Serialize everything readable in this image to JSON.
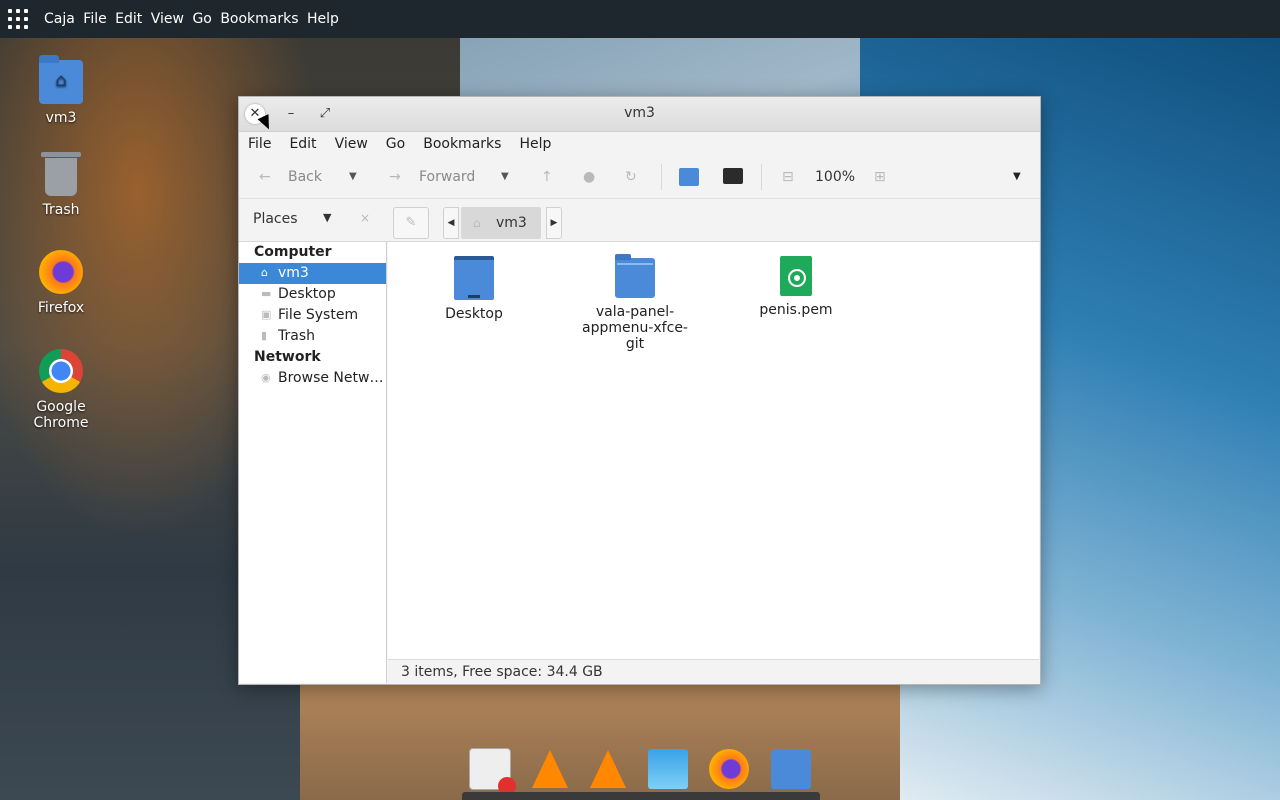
{
  "topbar": {
    "app_name": "Caja",
    "menu": [
      "File",
      "Edit",
      "View",
      "Go",
      "Bookmarks",
      "Help"
    ]
  },
  "desktop_icons": [
    {
      "label": "vm3",
      "icon": "home-folder-icon"
    },
    {
      "label": "Trash",
      "icon": "trash-icon"
    },
    {
      "label": "Firefox",
      "icon": "firefox-icon"
    },
    {
      "label": "Google Chrome",
      "icon": "chrome-icon"
    }
  ],
  "window": {
    "title": "vm3",
    "close_glyph": "✕",
    "minimize_glyph": "–",
    "maximize_glyph": "⤢",
    "menu": [
      "File",
      "Edit",
      "View",
      "Go",
      "Bookmarks",
      "Help"
    ],
    "toolbar": {
      "back_label": "Back",
      "forward_label": "Forward",
      "zoom_level": "100%"
    },
    "places": {
      "label": "Places",
      "dropdown_glyph": "▼",
      "close_glyph": "×"
    },
    "path": {
      "current": "vm3"
    },
    "sidebar": {
      "computer_header": "Computer",
      "computer_items": [
        {
          "label": "vm3",
          "icon": "home-icon",
          "active": true
        },
        {
          "label": "Desktop",
          "icon": "desktop-icon",
          "active": false
        },
        {
          "label": "File System",
          "icon": "drive-icon",
          "active": false
        },
        {
          "label": "Trash",
          "icon": "trash-icon",
          "active": false
        }
      ],
      "network_header": "Network",
      "network_items": [
        {
          "label": "Browse Netw…",
          "icon": "network-icon"
        }
      ]
    },
    "files": [
      {
        "name": "Desktop",
        "type": "desktop-folder"
      },
      {
        "name": "vala-panel-appmenu-xfce-git",
        "type": "folder",
        "line1": "vala-panel-",
        "line2": "appmenu-xfce-git"
      },
      {
        "name": "penis.pem",
        "type": "certificate"
      }
    ],
    "status": "3 items, Free space: 34.4 GB"
  },
  "dock": [
    "text-editor-icon",
    "vlc-icon",
    "vlc-icon",
    "image-viewer-icon",
    "firefox-icon",
    "file-manager-icon"
  ],
  "colors": {
    "selection": "#3c88d8",
    "folder": "#4a8ad9",
    "pem": "#1fa95a",
    "panel": "#1f272e"
  }
}
